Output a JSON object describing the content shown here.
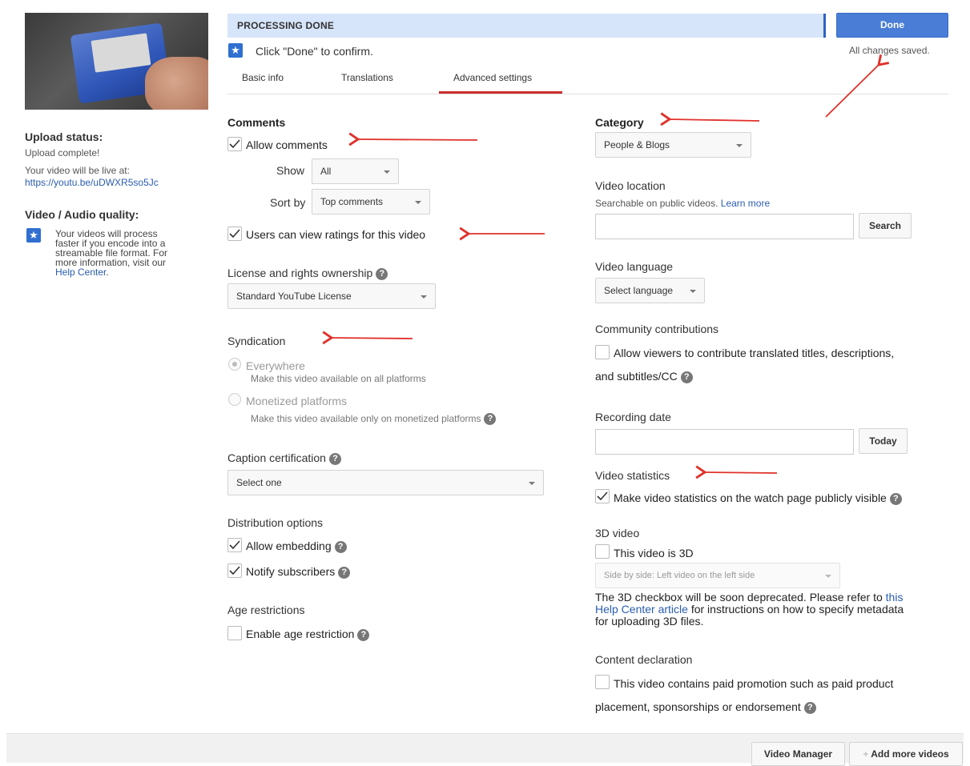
{
  "header": {
    "status_banner": "PROCESSING DONE",
    "done_label": "Done",
    "confirm_text": "Click \"Done\" to confirm.",
    "save_status": "All changes saved."
  },
  "tabs": [
    {
      "label": "Basic info"
    },
    {
      "label": "Translations"
    },
    {
      "label": "Advanced settings",
      "active": true
    }
  ],
  "sidebar": {
    "upload_status_title": "Upload status:",
    "upload_status_text": "Upload complete!",
    "live_at_text": "Your video will be live at:",
    "video_url": "https://youtu.be/uDWXR5so5Jc",
    "quality_title": "Video / Audio quality:",
    "quality_text_1": "Your videos will process",
    "quality_text_2": "faster if you encode into a",
    "quality_text_3": "streamable file format. For",
    "quality_text_4": "more information, visit our",
    "help_center_link": "Help Center",
    "help_center_period": "."
  },
  "comments": {
    "title": "Comments",
    "allow_label": "Allow comments",
    "allow_checked": true,
    "show_label": "Show",
    "show_value": "All",
    "sort_label": "Sort by",
    "sort_value": "Top comments",
    "ratings_label": "Users can view ratings for this video",
    "ratings_checked": true
  },
  "license": {
    "title": "License and rights ownership",
    "value": "Standard YouTube License"
  },
  "syndication": {
    "title": "Syndication",
    "opt1_label": "Everywhere",
    "opt1_desc": "Make this video available on all platforms",
    "opt2_label": "Monetized platforms",
    "opt2_desc": "Make this video available only on monetized platforms"
  },
  "caption": {
    "title": "Caption certification",
    "value": "Select one"
  },
  "distribution": {
    "title": "Distribution options",
    "embed_label": "Allow embedding",
    "embed_checked": true,
    "notify_label": "Notify subscribers",
    "notify_checked": true
  },
  "age": {
    "title": "Age restrictions",
    "enable_label": "Enable age restriction",
    "enable_checked": false
  },
  "category": {
    "title": "Category",
    "value": "People & Blogs"
  },
  "location": {
    "title": "Video location",
    "desc": "Searchable on public videos.",
    "learn_more": "Learn more",
    "input_value": "",
    "search_label": "Search"
  },
  "language": {
    "title": "Video language",
    "value": "Select language"
  },
  "community": {
    "title": "Community contributions",
    "label_line1": "Allow viewers to contribute translated titles, descriptions,",
    "label_line2": "and subtitles/CC",
    "checked": false
  },
  "recording": {
    "title": "Recording date",
    "input_value": "",
    "today_label": "Today"
  },
  "statistics": {
    "title": "Video statistics",
    "label": "Make video statistics on the watch page publicly visible",
    "checked": true
  },
  "video3d": {
    "title": "3D video",
    "label": "This video is 3D",
    "checked": false,
    "select_value": "Side by side: Left video on the left side",
    "note_1": "The 3D checkbox will be soon deprecated. Please refer to",
    "note_link_1": "this",
    "note_link_2": "Help Center article",
    "note_2": "for instructions on how to specify metadata",
    "note_3": "for uploading 3D files."
  },
  "content": {
    "title": "Content declaration",
    "label_line1": "This video contains paid promotion such as paid product",
    "label_line2": "placement, sponsorships or endorsement",
    "checked": false
  },
  "footer": {
    "video_manager": "Video Manager",
    "add_more": "Add more videos",
    "add_icon": "+"
  },
  "icons": {
    "help": "?",
    "star": "★"
  },
  "colors": {
    "accent_blue": "#4a7dd6",
    "banner_bg": "#d7e5fb",
    "tab_active_underline": "#c9302c",
    "annotation_arrow": "#e0312b",
    "link": "#2a5db0"
  }
}
